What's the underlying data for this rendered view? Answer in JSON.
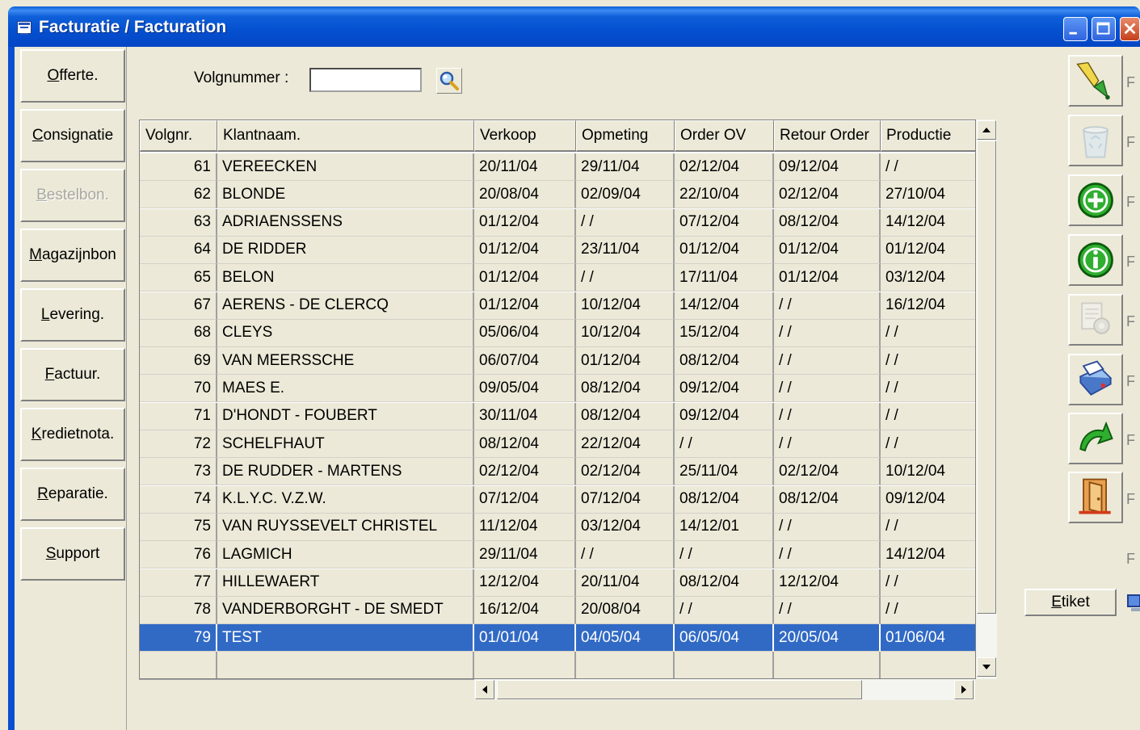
{
  "window": {
    "title": "Facturatie / Facturation"
  },
  "nav": {
    "items": [
      {
        "label": "Offerte.",
        "accel": "O",
        "rest": "fferte.",
        "enabled": true
      },
      {
        "label": "Consignatie",
        "accel": "C",
        "rest": "onsignatie",
        "enabled": true
      },
      {
        "label": "Bestelbon.",
        "accel": "B",
        "rest": "estelbon.",
        "enabled": false
      },
      {
        "label": "Magazijnbon",
        "accel": "M",
        "rest": "agazijnbon",
        "enabled": true
      },
      {
        "label": "Levering.",
        "accel": "L",
        "rest": "evering.",
        "enabled": true
      },
      {
        "label": "Factuur.",
        "accel": "F",
        "rest": "actuur.",
        "enabled": true
      },
      {
        "label": "Kredietnota.",
        "accel": "K",
        "rest": "redietnota.",
        "enabled": true
      },
      {
        "label": "Reparatie.",
        "accel": "R",
        "rest": "eparatie.",
        "enabled": true
      },
      {
        "label": "Support",
        "accel": "S",
        "rest": "upport",
        "enabled": true
      }
    ]
  },
  "search": {
    "label": "Volgnummer :",
    "value": ""
  },
  "grid": {
    "columns": [
      "Volgnr.",
      "Klantnaam.",
      "Verkoop",
      "Opmeting",
      "Order OV",
      "Retour Order",
      "Productie"
    ],
    "rows": [
      [
        "61",
        "VEREECKEN",
        "20/11/04",
        "29/11/04",
        "02/12/04",
        "09/12/04",
        " / /"
      ],
      [
        "62",
        "BLONDE",
        "20/08/04",
        "02/09/04",
        "22/10/04",
        "02/12/04",
        "27/10/04"
      ],
      [
        "63",
        "ADRIAENSSENS",
        "01/12/04",
        " / /",
        "07/12/04",
        "08/12/04",
        "14/12/04"
      ],
      [
        "64",
        "DE RIDDER",
        "01/12/04",
        "23/11/04",
        "01/12/04",
        "01/12/04",
        "01/12/04"
      ],
      [
        "65",
        "BELON",
        "01/12/04",
        " / /",
        "17/11/04",
        "01/12/04",
        "03/12/04"
      ],
      [
        "67",
        "AERENS - DE CLERCQ",
        "01/12/04",
        "10/12/04",
        "14/12/04",
        " / /",
        "16/12/04"
      ],
      [
        "68",
        "CLEYS",
        "05/06/04",
        "10/12/04",
        "15/12/04",
        " / /",
        " / /"
      ],
      [
        "69",
        "VAN MEERSSCHE",
        "06/07/04",
        "01/12/04",
        "08/12/04",
        " / /",
        " / /"
      ],
      [
        "70",
        "MAES E.",
        "09/05/04",
        "08/12/04",
        "09/12/04",
        " / /",
        " / /"
      ],
      [
        "71",
        "D'HONDT - FOUBERT",
        "30/11/04",
        "08/12/04",
        "09/12/04",
        " / /",
        " / /"
      ],
      [
        "72",
        "SCHELFHAUT",
        "08/12/04",
        "22/12/04",
        " / /",
        " / /",
        " / /"
      ],
      [
        "73",
        "DE RUDDER - MARTENS",
        "02/12/04",
        "02/12/04",
        "25/11/04",
        "02/12/04",
        "10/12/04"
      ],
      [
        "74",
        "K.L.Y.C. V.Z.W.",
        "07/12/04",
        "07/12/04",
        "08/12/04",
        "08/12/04",
        "09/12/04"
      ],
      [
        "75",
        "VAN RUYSSEVELT CHRISTEL",
        "11/12/04",
        "03/12/04",
        "14/12/01",
        " / /",
        " / /"
      ],
      [
        "76",
        "LAGMICH",
        "29/11/04",
        " / /",
        " / /",
        " / /",
        "14/12/04"
      ],
      [
        "77",
        "HILLEWAERT",
        "12/12/04",
        "20/11/04",
        "08/12/04",
        "12/12/04",
        " / /"
      ],
      [
        "78",
        "VANDERBORGHT - DE SMEDT",
        "16/12/04",
        "20/08/04",
        " / /",
        " / /",
        " / /"
      ],
      [
        "79",
        "TEST",
        "01/01/04",
        "04/05/04",
        "06/05/04",
        "20/05/04",
        "01/06/04"
      ]
    ],
    "selected_row": 17
  },
  "toolbar": {
    "buttons": [
      {
        "icon": "pen-icon",
        "key": "F",
        "enabled": true
      },
      {
        "icon": "recycle-bin-icon",
        "key": "F",
        "enabled": false
      },
      {
        "icon": "add-icon",
        "key": "F",
        "enabled": true
      },
      {
        "icon": "info-icon",
        "key": "F",
        "enabled": true
      },
      {
        "icon": "document-gear-icon",
        "key": "F",
        "enabled": false
      },
      {
        "icon": "printer-icon",
        "key": "F",
        "enabled": true
      },
      {
        "icon": "undo-arrow-icon",
        "key": "F",
        "enabled": true
      },
      {
        "icon": "exit-door-icon",
        "key": "F",
        "enabled": true
      }
    ],
    "f9_key": "F",
    "etiket": {
      "accel": "E",
      "rest": "tiket"
    }
  },
  "colors": {
    "title_bar": "#0450d0",
    "selection": "#316ac5",
    "face": "#ece9d8"
  }
}
